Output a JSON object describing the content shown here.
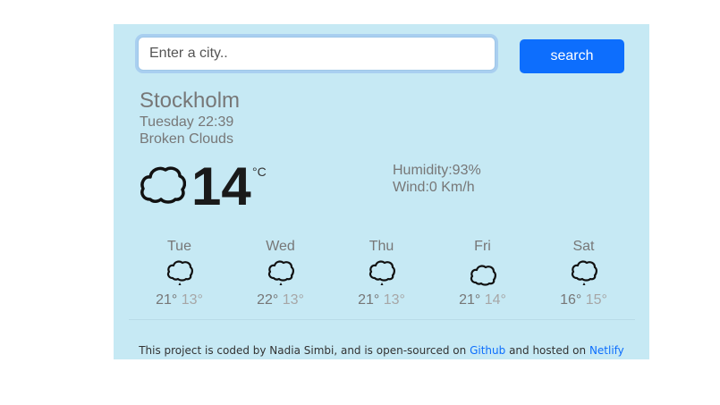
{
  "search": {
    "placeholder": "Enter a city..",
    "button_label": "search"
  },
  "current": {
    "city": "Stockholm",
    "datetime": "Tuesday 22:39",
    "description": "Broken Clouds",
    "icon": "cloud-icon",
    "temperature": "14",
    "unit": "°C",
    "humidity": "Humidity:93%",
    "wind": "Wind:0 Km/h"
  },
  "forecast": [
    {
      "day": "Tue",
      "icon": "cloud-rain-icon",
      "max": "21°",
      "min": "13°"
    },
    {
      "day": "Wed",
      "icon": "cloud-rain-icon",
      "max": "22°",
      "min": "13°"
    },
    {
      "day": "Thu",
      "icon": "cloud-rain-icon",
      "max": "21°",
      "min": "13°"
    },
    {
      "day": "Fri",
      "icon": "cloud-icon",
      "max": "21°",
      "min": "14°"
    },
    {
      "day": "Sat",
      "icon": "cloud-rain-icon",
      "max": "16°",
      "min": "15°"
    }
  ],
  "footer": {
    "text_before": "This project is coded by Nadia Simbi, and is open-sourced on ",
    "github_link": "Github",
    "text_middle": " and hosted on ",
    "netlify_link": "Netlify"
  },
  "colors": {
    "panel_bg": "#c6e9f4",
    "button_bg": "#0d6efd",
    "link": "#0d6efd"
  }
}
